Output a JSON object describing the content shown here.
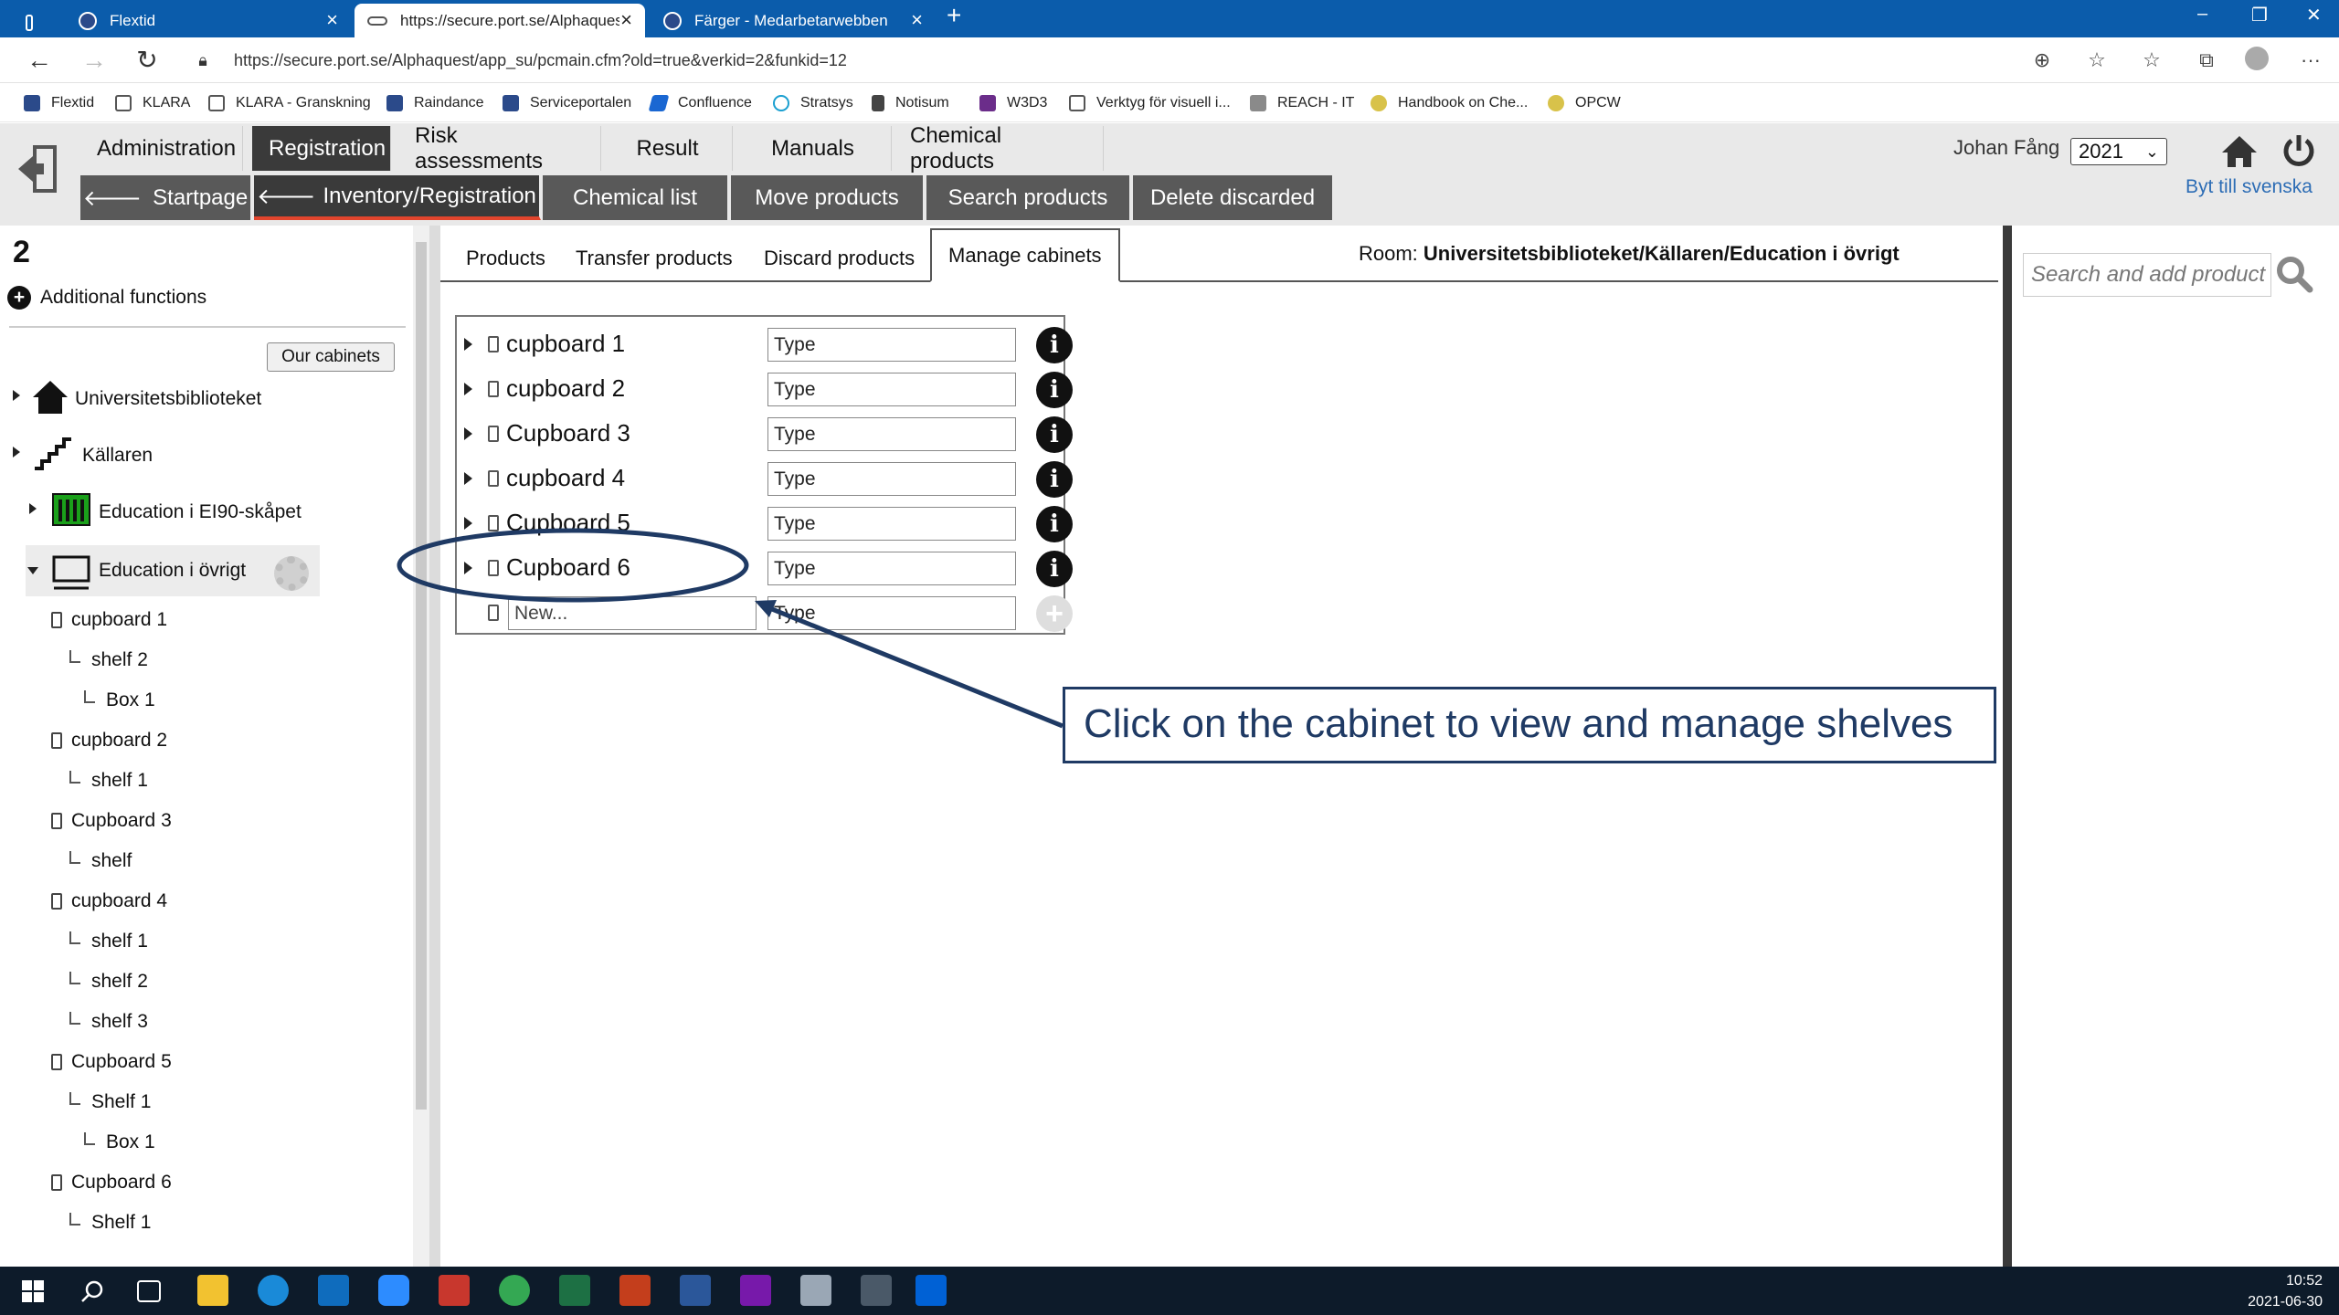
{
  "browser": {
    "tabs": [
      {
        "label": "Flextid",
        "active": false
      },
      {
        "label": "https://secure.port.se/Alphaques",
        "active": true
      },
      {
        "label": "Färger - Medarbetarwebben",
        "active": false
      }
    ],
    "url": "https://secure.port.se/Alphaquest/app_su/pcmain.cfm?old=true&verkid=2&funkid=12",
    "bookmarks": [
      "Flextid",
      "KLARA",
      "KLARA - Granskning",
      "Raindance",
      "Serviceportalen",
      "Confluence",
      "Stratsys",
      "Notisum",
      "W3D3",
      "Verktyg för visuell i...",
      "REACH - IT",
      "Handbook on Che...",
      "OPCW"
    ]
  },
  "header": {
    "main_tabs": [
      "Administration",
      "Registration",
      "Risk assessments",
      "Result",
      "Manuals",
      "Chemical products"
    ],
    "active_main_tab": "Registration",
    "sub_tabs": [
      "Startpage",
      "Inventory/Registration",
      "Chemical list",
      "Move products",
      "Search products",
      "Delete discarded"
    ],
    "active_sub_tab": "Inventory/Registration",
    "user": "Johan Fång",
    "year": "2021",
    "language_link": "Byt till svenska"
  },
  "sidebar": {
    "count": "2",
    "additional_functions": "Additional functions",
    "our_cabinets": "Our cabinets",
    "locations": [
      "Universitetsbiblioteket",
      "Källaren",
      "Education i EI90-skåpet",
      "Education i övrigt"
    ],
    "tree": [
      {
        "label": "cupboard 1",
        "kind": "cabinet"
      },
      {
        "label": "shelf 2",
        "kind": "shelf"
      },
      {
        "label": "Box 1",
        "kind": "box"
      },
      {
        "label": "cupboard 2",
        "kind": "cabinet"
      },
      {
        "label": "shelf 1",
        "kind": "shelf"
      },
      {
        "label": "Cupboard 3",
        "kind": "cabinet"
      },
      {
        "label": "shelf",
        "kind": "shelf"
      },
      {
        "label": "cupboard 4",
        "kind": "cabinet"
      },
      {
        "label": "shelf 1",
        "kind": "shelf"
      },
      {
        "label": "shelf 2",
        "kind": "shelf"
      },
      {
        "label": "shelf 3",
        "kind": "shelf"
      },
      {
        "label": "Cupboard 5",
        "kind": "cabinet"
      },
      {
        "label": "Shelf 1",
        "kind": "shelf"
      },
      {
        "label": "Box 1",
        "kind": "box"
      },
      {
        "label": "Cupboard 6",
        "kind": "cabinet"
      },
      {
        "label": "Shelf 1",
        "kind": "shelf"
      }
    ]
  },
  "content": {
    "tabs": [
      "Products",
      "Transfer products",
      "Discard products",
      "Manage cabinets"
    ],
    "active_tab": "Manage cabinets",
    "room_label": "Room:",
    "room_path": "Universitetsbiblioteket/Källaren/Education i övrigt",
    "cabinets": [
      {
        "name": "cupboard 1",
        "type_placeholder": "Type"
      },
      {
        "name": "cupboard 2",
        "type_placeholder": "Type"
      },
      {
        "name": "Cupboard 3",
        "type_placeholder": "Type"
      },
      {
        "name": "cupboard 4",
        "type_placeholder": "Type"
      },
      {
        "name": "Cupboard 5",
        "type_placeholder": "Type"
      },
      {
        "name": "Cupboard 6",
        "type_placeholder": "Type"
      }
    ],
    "new_placeholder": "New...",
    "new_type_placeholder": "Type",
    "callout": "Click on the cabinet to view and manage shelves"
  },
  "search": {
    "placeholder": "Search and add product"
  },
  "taskbar": {
    "time": "10:52",
    "date": "2021-06-30"
  },
  "colors": {
    "tabstrip": "#0b5cab",
    "active_tab_underline": "#e2452d",
    "callout": "#1f3a64",
    "link": "#2d6db5"
  }
}
